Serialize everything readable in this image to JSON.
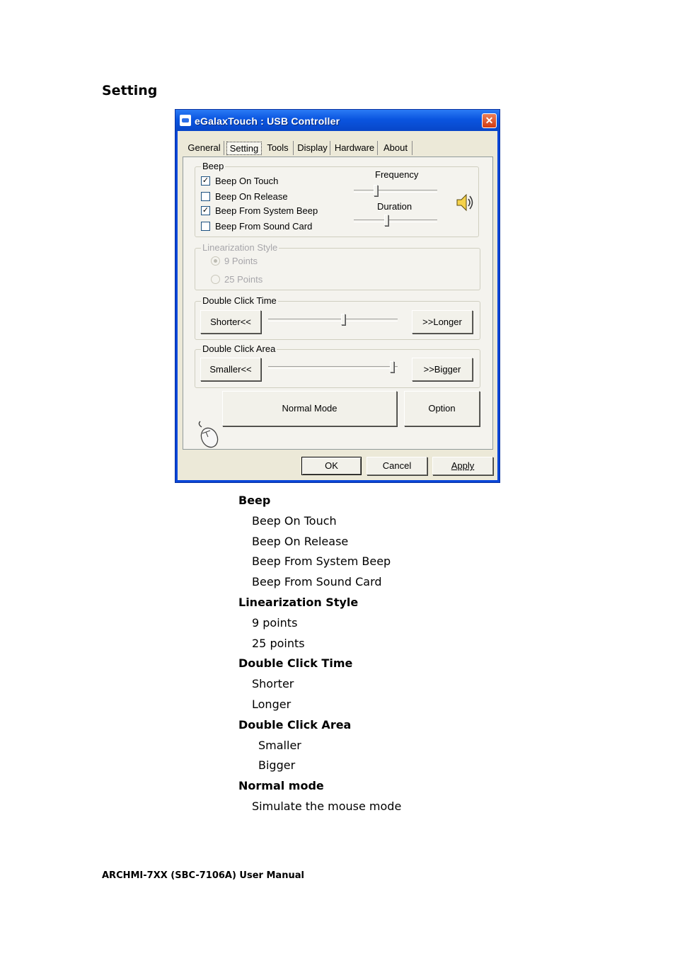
{
  "section_title": "Setting",
  "window": {
    "title": "eGalaxTouch : USB Controller",
    "close_glyph": "✕",
    "tabs": [
      "General",
      "Setting",
      "Tools",
      "Display",
      "Hardware",
      "About"
    ],
    "active_tab": "Setting",
    "beep_group": {
      "label": "Beep",
      "options": [
        {
          "label": "Beep On Touch",
          "checked": true
        },
        {
          "label": "Beep On Release",
          "checked": false
        },
        {
          "label": "Beep From System Beep",
          "checked": true
        },
        {
          "label": "Beep From Sound Card",
          "checked": false
        }
      ],
      "frequency_label": "Frequency",
      "duration_label": "Duration",
      "frequency_level": 0.25,
      "duration_level": 0.38
    },
    "linearization_group": {
      "label": "Linearization Style",
      "options": [
        {
          "label": "9 Points",
          "selected": true
        },
        {
          "label": "25 Points",
          "selected": false
        }
      ]
    },
    "double_click_time": {
      "label": "Double Click Time",
      "shorter_label": "Shorter<<",
      "longer_label": ">>Longer",
      "level": 0.58
    },
    "double_click_area": {
      "label": "Double Click Area",
      "smaller_label": "Smaller<<",
      "bigger_label": ">>Bigger",
      "level": 0.97
    },
    "normal_mode_label": "Normal Mode",
    "option_label": "Option",
    "ok_label": "OK",
    "cancel_label": "Cancel",
    "apply_label": "Apply"
  },
  "doc_list": [
    {
      "text": "Beep",
      "type": "heading"
    },
    {
      "text": "Beep On Touch",
      "type": "item"
    },
    {
      "text": "Beep On Release",
      "type": "item"
    },
    {
      "text": "Beep From System Beep",
      "type": "item"
    },
    {
      "text": "Beep From Sound Card",
      "type": "item"
    },
    {
      "text": "Linearization Style",
      "type": "heading"
    },
    {
      "text": "9 points",
      "type": "item"
    },
    {
      "text": "25 points",
      "type": "item"
    },
    {
      "text": "Double Click Time",
      "type": "heading"
    },
    {
      "text": "Shorter",
      "type": "item"
    },
    {
      "text": "Longer",
      "type": "item"
    },
    {
      "text": "Double Click Area",
      "type": "heading"
    },
    {
      "text": "Smaller",
      "type": "item2"
    },
    {
      "text": "Bigger",
      "type": "item2"
    },
    {
      "text": "Normal mode",
      "type": "heading"
    },
    {
      "text": "Simulate the mouse mode",
      "type": "item"
    }
  ],
  "footer": "ARCHMI-7XX (SBC-7106A) User Manual"
}
